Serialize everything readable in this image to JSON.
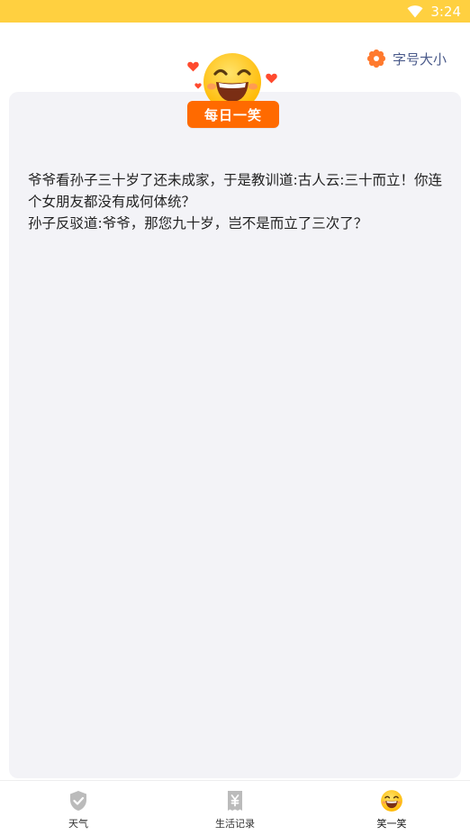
{
  "status_bar": {
    "time": "3:24",
    "color": "#FFD040"
  },
  "header": {
    "font_size_label": "字号大小",
    "font_size_icon": "flower-gear-icon",
    "accent_color": "#FF7A2E"
  },
  "hero": {
    "badge_label": "每日一笑",
    "badge_color": "#FF6A00",
    "mascot_icon": "laughing-emoji-icon"
  },
  "joke": {
    "text": "爷爷看孙子三十岁了还未成家，于是教训道:古人云:三十而立！你连个女朋友都没有成何体统？\n孙子反驳道:爷爷，那您九十岁，岂不是而立了三次了？"
  },
  "bottom_nav": {
    "items": [
      {
        "label": "天气",
        "icon": "shield-check-icon",
        "active": false
      },
      {
        "label": "生活记录",
        "icon": "yen-receipt-icon",
        "active": false
      },
      {
        "label": "笑一笑",
        "icon": "laughing-emoji-icon",
        "active": true
      }
    ]
  }
}
